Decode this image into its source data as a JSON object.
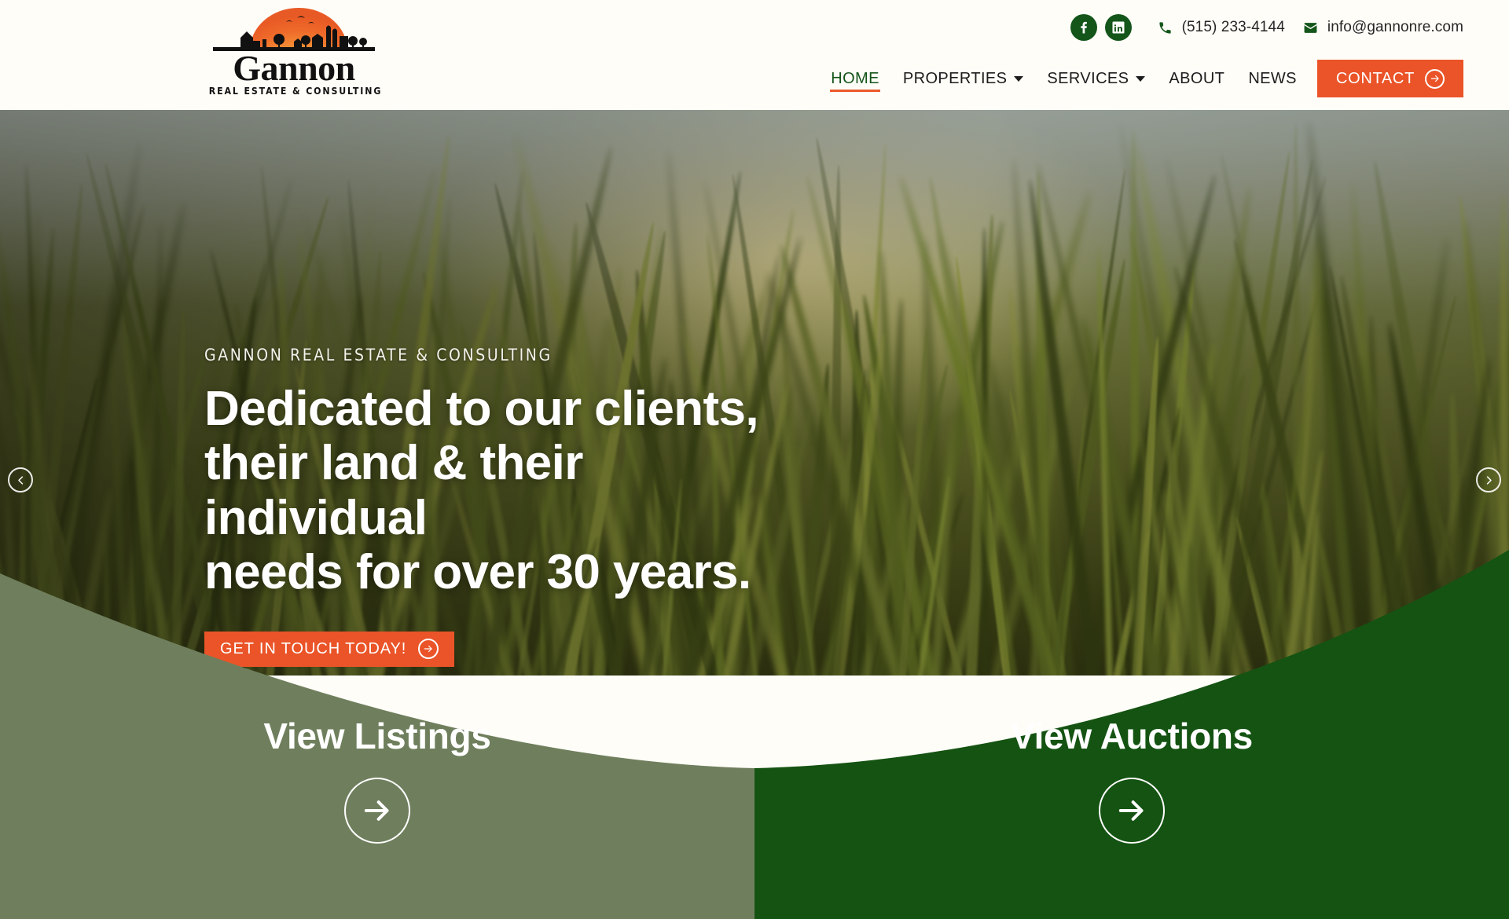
{
  "brand": {
    "name": "Gannon",
    "tagline": "REAL ESTATE & CONSULTING",
    "colors": {
      "green": "#14551a",
      "dark_green_panel": "#145312",
      "muted_green_panel": "#6f7f5d",
      "orange": "#ea5428",
      "header_bg": "#fffdf8"
    }
  },
  "topbar": {
    "social": [
      {
        "name": "facebook-icon",
        "label": "Facebook"
      },
      {
        "name": "linkedin-icon",
        "label": "LinkedIn"
      }
    ],
    "phone": "(515) 233-4144",
    "email": "info@gannonre.com"
  },
  "nav": {
    "items": [
      {
        "label": "HOME",
        "active": true,
        "dropdown": false
      },
      {
        "label": "PROPERTIES",
        "active": false,
        "dropdown": true
      },
      {
        "label": "SERVICES",
        "active": false,
        "dropdown": true
      },
      {
        "label": "ABOUT",
        "active": false,
        "dropdown": false
      },
      {
        "label": "NEWS",
        "active": false,
        "dropdown": false
      }
    ],
    "cta": "CONTACT"
  },
  "hero": {
    "eyebrow": "GANNON REAL ESTATE & CONSULTING",
    "headline_line1": "Dedicated to our clients,",
    "headline_line2": "their land & their individual",
    "headline_line3": "needs for over 30 years.",
    "cta": "GET IN TOUCH TODAY!",
    "carousel_prev": "Previous slide",
    "carousel_next": "Next slide"
  },
  "panels": {
    "left": {
      "title": "View Listings"
    },
    "right": {
      "title": "View Auctions"
    }
  }
}
